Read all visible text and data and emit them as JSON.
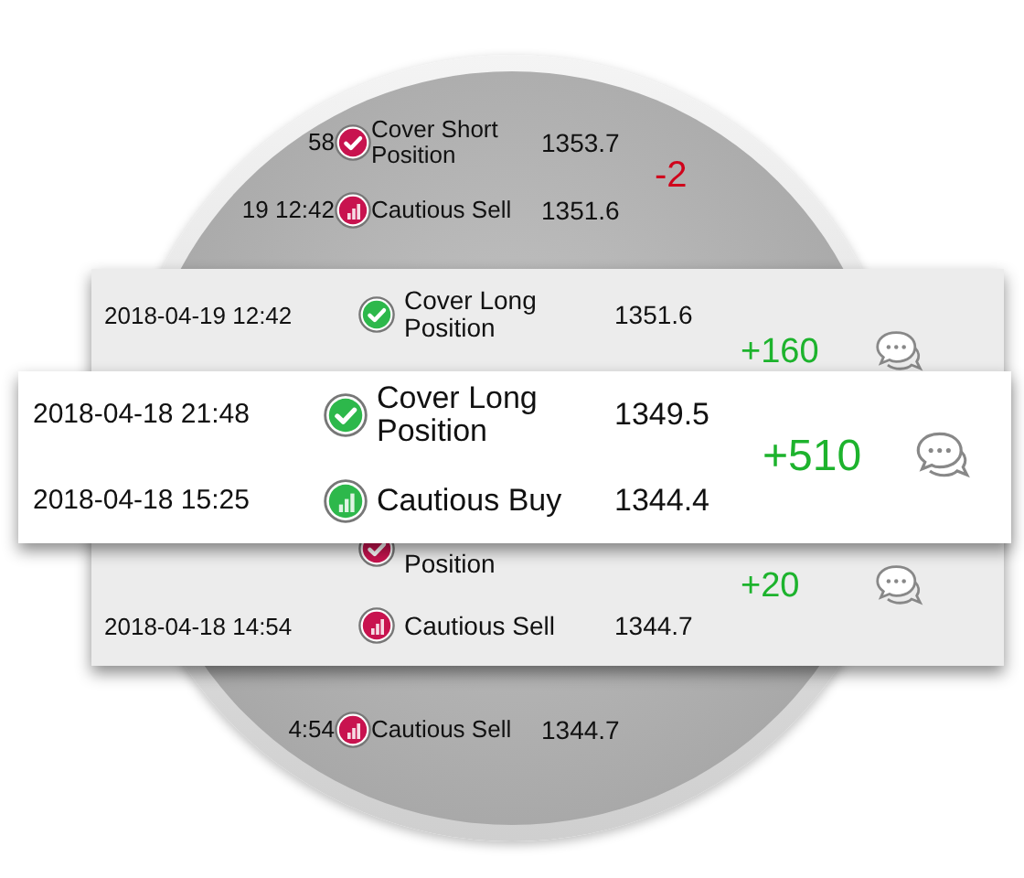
{
  "background_list": {
    "groups": [
      {
        "rows": [
          {
            "time": "58",
            "kind": "check",
            "color": "#c8134f",
            "signal": "Cover Short Position",
            "price": "1353.7"
          },
          {
            "time": "19 12:42",
            "kind": "bars",
            "color": "#c8134f",
            "signal": "Cautious Sell",
            "price": "1351.6"
          }
        ],
        "change": "-2",
        "color": "#d0021b"
      },
      {
        "rows": [
          {
            "time": "4:54",
            "kind": "bars",
            "color": "#c8134f",
            "signal": "Cautious Sell",
            "price": "1344.7"
          }
        ]
      }
    ]
  },
  "middle_card": {
    "groups": [
      {
        "rows": [
          {
            "time": "2018-04-19 12:42",
            "kind": "check",
            "color": "#2db84b",
            "signal": "Cover Long Position",
            "price": "1351.6"
          }
        ],
        "change": "+160",
        "color": "#1db32d"
      },
      {
        "rows": [
          {
            "kind": "check",
            "color": "#c8134f",
            "signal": "Position"
          },
          {
            "time": "2018-04-18 14:54",
            "kind": "bars",
            "color": "#c8134f",
            "signal": "Cautious Sell",
            "price": "1344.7"
          }
        ],
        "change": "+20",
        "color": "#1db32d"
      }
    ]
  },
  "front_card": {
    "groups": [
      {
        "rows": [
          {
            "time": "2018-04-18 21:48",
            "kind": "check",
            "color": "#2db84b",
            "signal": "Cover Long Position",
            "price": "1349.5"
          },
          {
            "time": "2018-04-18 15:25",
            "kind": "bars",
            "color": "#2db84b",
            "signal": "Cautious Buy",
            "price": "1344.4"
          }
        ],
        "change": "+510",
        "color": "#1db32d"
      }
    ]
  }
}
